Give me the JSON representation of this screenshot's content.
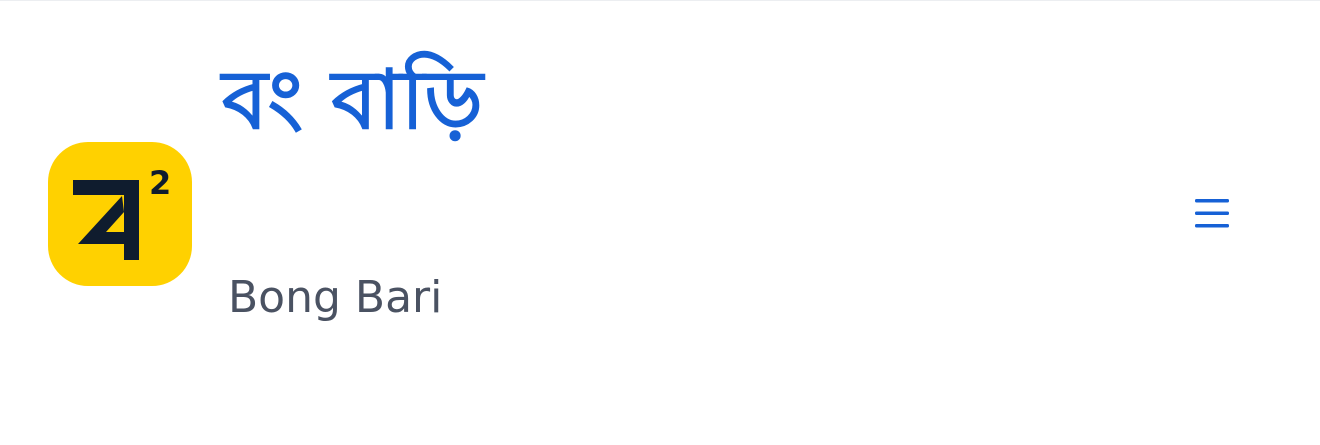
{
  "site": {
    "title": "বং বাড়ি",
    "tagline": "Bong Bari"
  },
  "logo": {
    "letter": "ব",
    "superscript": "2",
    "background_color": "#ffd100",
    "glyph_color": "#0f1c2e"
  },
  "menu": {
    "icon": "hamburger-menu-icon",
    "color": "#1661d6"
  },
  "colors": {
    "title": "#1661d6",
    "tagline": "#4a5262",
    "background": "#ffffff"
  }
}
